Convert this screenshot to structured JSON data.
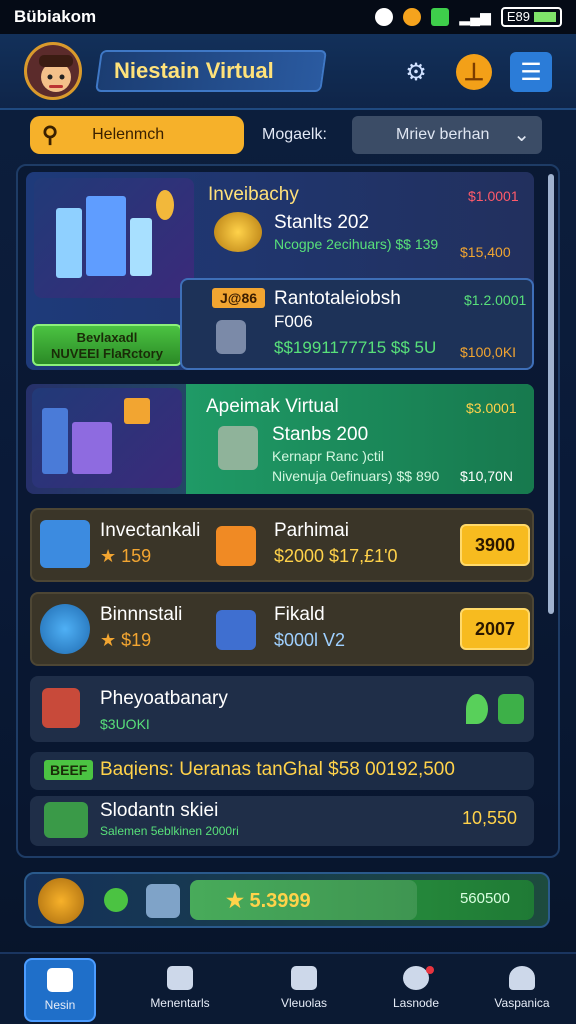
{
  "status_bar": {
    "carrier": "Bübiakom",
    "battery": "E89"
  },
  "header": {
    "title": "Niestain Virtual",
    "settings_icon": "gear-icon",
    "coin_icon": "coin-icon",
    "menu_icon": "menu-icon"
  },
  "search": {
    "placeholder": "Helenmch",
    "filter_label": "Mogaelk:",
    "select_value": "Mriev berhan"
  },
  "cards": {
    "feature1": {
      "title": "Inveibachy",
      "amount": "$1.0001",
      "subtitle": "Stanlts 202",
      "detail": "Ncogpe 2ecihuars) $$ 139",
      "side": "$15,400",
      "button": "Bevlaxadl\nNUVEEI FlaRctory"
    },
    "feature2": {
      "tag": "J@86",
      "title": "Rantotaleiobsh",
      "subtitle": "F006",
      "amount": "$1.2.0001",
      "detail": "$$1991177715 $$ 5U",
      "side": "$100,0KI"
    },
    "feature3": {
      "title": "Apeimak Virtual",
      "amount": "$3.0001",
      "subtitle": "Stanbs 200",
      "detail1": "Kernapr Ranc )ctil",
      "detail2": "Nivenuja 0efinuars) $$ 890",
      "side": "$10,70N"
    },
    "row1": {
      "title": "Invectankali",
      "price": "★ 159",
      "title2": "Parhimai",
      "price2": "$2000 $17,£1'0",
      "button": "3900"
    },
    "row2": {
      "title": "Binnnstali",
      "price": "★ $19",
      "title2": "Fikald",
      "price2": "$000l V2",
      "button": "2007"
    },
    "row3": {
      "title": "Pheyoatbanary",
      "sub": "$3UOKI"
    },
    "promo": {
      "badge": "BEEF",
      "text": "Baqiens: Ueranas tanGhal $58 00192,500"
    },
    "row4": {
      "title": "Slodantn skiei",
      "sub": "Salemen 5eblkinen 2000ri",
      "value": "10,550"
    }
  },
  "bottom_bar": {
    "progress_value": "★ 5.3999",
    "progress_right": "560500",
    "progress_fraction": 0.66
  },
  "nav": {
    "items": [
      {
        "label": "Nesin",
        "icon": "home-icon"
      },
      {
        "label": "Menentarls",
        "icon": "users-icon"
      },
      {
        "label": "Vleuolas",
        "icon": "gift-icon"
      },
      {
        "label": "Lasnode",
        "icon": "clock-icon"
      },
      {
        "label": "Vaspanica",
        "icon": "profile-icon"
      }
    ]
  },
  "colors": {
    "accent": "#f6b12a",
    "green": "#4bc342",
    "background": "#0d1f3d"
  }
}
